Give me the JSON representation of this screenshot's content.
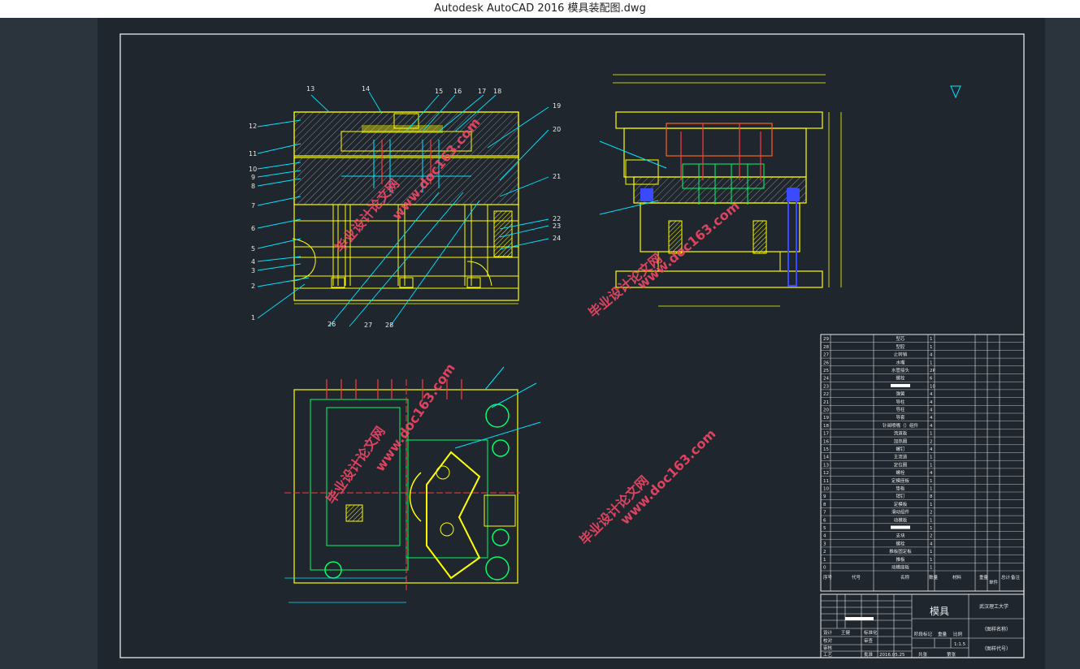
{
  "window": {
    "title": "Autodesk AutoCAD 2016     模具装配图.dwg"
  },
  "drawing": {
    "part_numbers_left": [
      "13",
      "14",
      "15",
      "16",
      "17",
      "18",
      "19",
      "20",
      "21",
      "22",
      "23",
      "24",
      "12",
      "11",
      "10",
      "9",
      "8",
      "7",
      "6",
      "5",
      "4",
      "3",
      "2",
      "1",
      "26",
      "27",
      "28"
    ],
    "watermarks": [
      "毕业设计论文网",
      "www.doc163.com"
    ],
    "bom": {
      "rows": [
        {
          "no": "29",
          "name": "型芯",
          "qty": "1"
        },
        {
          "no": "28",
          "name": "型腔",
          "qty": "1"
        },
        {
          "no": "27",
          "name": "止转销",
          "qty": "4"
        },
        {
          "no": "26",
          "name": "水嘴",
          "qty": "1"
        },
        {
          "no": "25",
          "name": "水管接头",
          "qty": "2P"
        },
        {
          "no": "24",
          "name": "螺栓",
          "qty": "6"
        },
        {
          "no": "23",
          "name": "",
          "qty": "10"
        },
        {
          "no": "22",
          "name": "弹簧",
          "qty": "4"
        },
        {
          "no": "21",
          "name": "导柱",
          "qty": "4"
        },
        {
          "no": "20",
          "name": "导柱",
          "qty": "4"
        },
        {
          "no": "19",
          "name": "导套",
          "qty": "4"
        },
        {
          "no": "18",
          "name": "针阀喷嘴（）组件",
          "qty": "4"
        },
        {
          "no": "17",
          "name": "流道板",
          "qty": "1"
        },
        {
          "no": "16",
          "name": "加热圈",
          "qty": "2"
        },
        {
          "no": "15",
          "name": "螺钉",
          "qty": "4"
        },
        {
          "no": "14",
          "name": "主流道",
          "qty": "1"
        },
        {
          "no": "13",
          "name": "定位圈",
          "qty": "1"
        },
        {
          "no": "12",
          "name": "螺栓",
          "qty": "4"
        },
        {
          "no": "11",
          "name": "定模座板",
          "qty": "1"
        },
        {
          "no": "10",
          "name": "垫板",
          "qty": "1"
        },
        {
          "no": "9",
          "name": "销钉",
          "qty": "8"
        },
        {
          "no": "8",
          "name": "定模板",
          "qty": "1"
        },
        {
          "no": "7",
          "name": "滑动组件",
          "qty": "2"
        },
        {
          "no": "6",
          "name": "动模板",
          "qty": "1"
        },
        {
          "no": "5",
          "name": "",
          "qty": "1"
        },
        {
          "no": "4",
          "name": "支块",
          "qty": "2"
        },
        {
          "no": "3",
          "name": "螺栓",
          "qty": "4"
        },
        {
          "no": "2",
          "name": "推板固定板",
          "qty": "1"
        },
        {
          "no": "1",
          "name": "推板",
          "qty": "1"
        },
        {
          "no": "0",
          "name": "动模座板",
          "qty": "1"
        }
      ],
      "header": {
        "col_no": "序号",
        "col_code": "代号",
        "col_name": "名称",
        "col_qty": "数量",
        "col_material": "材料",
        "col_weight": "重量",
        "col_unit": "单件",
        "col_total": "总计",
        "col_note": "备注"
      }
    },
    "title_block": {
      "drawing_name": "模具",
      "school": "武汉理工大学",
      "figure_name": "（图样名称）",
      "figure_code": "（图样代号）",
      "designer_label": "设计",
      "designer": "王健",
      "standard_label": "标准化",
      "check_label": "校对",
      "review_label": "审查",
      "audit_label": "审核",
      "process_label": "工艺",
      "approve_label": "批准",
      "date": "2016.05.25",
      "mark_label": "阶段标记",
      "weight_label": "重量",
      "scale_label": "比例",
      "scale": "1:1.5",
      "sheets_label": "共张",
      "sheet_label": "第张"
    }
  }
}
